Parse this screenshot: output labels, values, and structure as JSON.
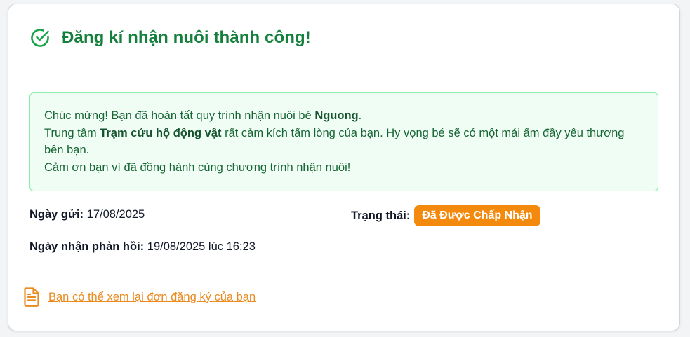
{
  "header": {
    "title": "Đăng kí nhận nuôi thành công!"
  },
  "message": {
    "line1_prefix": "Chúc mừng! Bạn đã hoàn tất quy trình nhận nuôi bé ",
    "pet_name": "Nguong",
    "line1_suffix": ".",
    "line2_prefix": "Trung tâm ",
    "center_name": "Trạm cứu hộ động vật",
    "line2_suffix": " rất cảm kích tấm lòng của bạn. Hy vọng bé sẽ có một mái ấm đầy yêu thương bên bạn.",
    "line3": "Cảm ơn bạn vì đã đồng hành cùng chương trình nhận nuôi!"
  },
  "details": {
    "sent_label": "Ngày gửi:",
    "sent_value": "17/08/2025",
    "reply_label": "Ngày nhận phản hồi:",
    "reply_value": "19/08/2025 lúc 16:23",
    "status_label": "Trạng thái:",
    "status_value": "Đã Được Chấp Nhận"
  },
  "link": {
    "label": "Bạn có thể xem lại đơn đăng ký của bạn"
  },
  "colors": {
    "success_green": "#15803d",
    "status_orange": "#f38a0e",
    "link_orange": "#ea8a1f"
  },
  "icons": {
    "header": "check-circle-icon",
    "link": "document-icon"
  }
}
